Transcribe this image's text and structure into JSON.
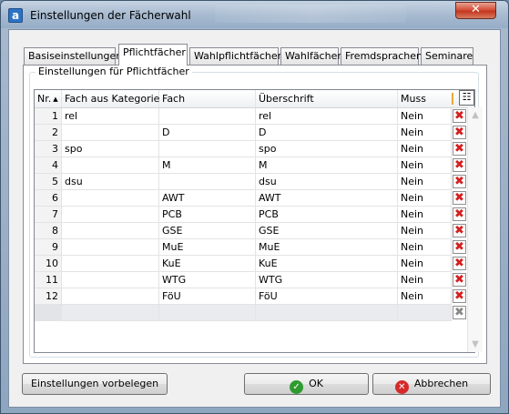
{
  "window": {
    "title": "Einstellungen der Fächerwahl",
    "app_icon_letter": "a",
    "close_label": "✕"
  },
  "tabs": [
    {
      "label": "Basiseinstellungen"
    },
    {
      "label": "Pflichtfächer"
    },
    {
      "label": "Wahlpflichtfächer"
    },
    {
      "label": "Wahlfächer"
    },
    {
      "label": "Fremdsprachen"
    },
    {
      "label": "Seminare"
    }
  ],
  "active_tab": "Pflichtfächer",
  "group": {
    "title": "Einstellungen für Pflichtfächer"
  },
  "grid": {
    "headers": {
      "nr": "Nr.",
      "kategorie": "Fach aus Kategorie",
      "fach": "Fach",
      "ueberschrift": "Überschrift",
      "muss": "Muss"
    },
    "sort_indicator": "▲",
    "rows": [
      {
        "nr": "1",
        "kategorie": "rel",
        "fach": "",
        "ueberschrift": "rel",
        "muss": "Nein"
      },
      {
        "nr": "2",
        "kategorie": "",
        "fach": "D",
        "ueberschrift": "D",
        "muss": "Nein"
      },
      {
        "nr": "3",
        "kategorie": "spo",
        "fach": "",
        "ueberschrift": "spo",
        "muss": "Nein"
      },
      {
        "nr": "4",
        "kategorie": "",
        "fach": "M",
        "ueberschrift": "M",
        "muss": "Nein"
      },
      {
        "nr": "5",
        "kategorie": "dsu",
        "fach": "",
        "ueberschrift": "dsu",
        "muss": "Nein"
      },
      {
        "nr": "6",
        "kategorie": "",
        "fach": "AWT",
        "ueberschrift": "AWT",
        "muss": "Nein"
      },
      {
        "nr": "7",
        "kategorie": "",
        "fach": "PCB",
        "ueberschrift": "PCB",
        "muss": "Nein"
      },
      {
        "nr": "8",
        "kategorie": "",
        "fach": "GSE",
        "ueberschrift": "GSE",
        "muss": "Nein"
      },
      {
        "nr": "9",
        "kategorie": "",
        "fach": "MuE",
        "ueberschrift": "MuE",
        "muss": "Nein"
      },
      {
        "nr": "10",
        "kategorie": "",
        "fach": "KuE",
        "ueberschrift": "KuE",
        "muss": "Nein"
      },
      {
        "nr": "11",
        "kategorie": "",
        "fach": "WTG",
        "ueberschrift": "WTG",
        "muss": "Nein"
      },
      {
        "nr": "12",
        "kategorie": "",
        "fach": "FöU",
        "ueberschrift": "FöU",
        "muss": "Nein"
      }
    ],
    "delete_glyph": "✖",
    "header_icon": "column-chooser-icon"
  },
  "buttons": {
    "defaults": "Einstellungen vorbelegen",
    "ok": "OK",
    "cancel": "Abbrechen"
  },
  "colors": {
    "delete_red": "#d42020",
    "ok_green": "#2e9b2e",
    "cancel_red": "#d62a2a",
    "titlebar": "#a5b9cf"
  }
}
